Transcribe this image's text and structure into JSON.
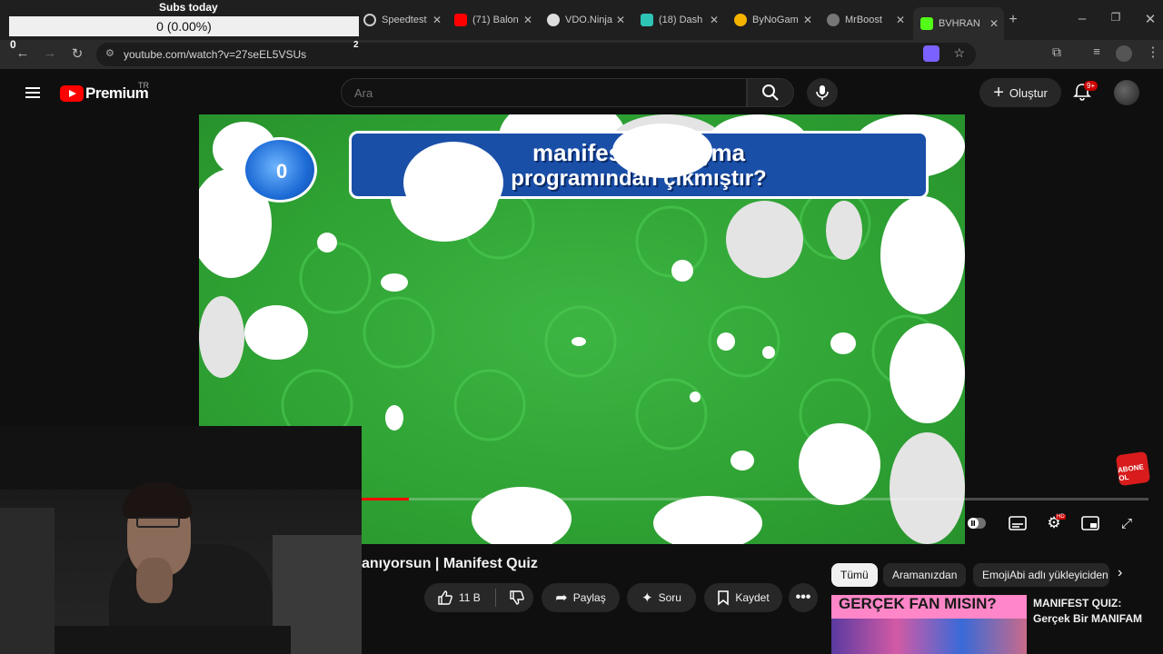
{
  "browser": {
    "tabs": [
      {
        "label": "Speedtest",
        "icon": "speedtest-icon",
        "color": "#1a1a1a"
      },
      {
        "label": "(71) Balon",
        "icon": "youtube-icon",
        "color": "#ff0000"
      },
      {
        "label": "VDO.Ninja",
        "icon": "vdo-icon",
        "color": "#dddddd"
      },
      {
        "label": "(18) Dash",
        "icon": "dashboard-icon",
        "color": "#2ec4b6"
      },
      {
        "label": "ByNoGam",
        "icon": "nogam-icon",
        "color": "#f5b400"
      },
      {
        "label": "MrBoost",
        "icon": "globe-icon",
        "color": "#777777"
      },
      {
        "label": "BVHRAN",
        "icon": "kick-icon",
        "color": "#53fc18"
      }
    ],
    "url": "youtube.com/watch?v=27seEL5VSUs"
  },
  "overlay": {
    "title": "Subs today",
    "value": "0 (0.00%)",
    "left_count": "0",
    "right_count": "2"
  },
  "youtube": {
    "logo_text": "Premium",
    "region": "TR",
    "search_placeholder": "Ara",
    "create_label": "Oluştur",
    "notification_badge": "9+"
  },
  "video": {
    "question_line1": "manifest gu... ışma",
    "question_line2": "programından çıkmıştır?",
    "timer_value": "0",
    "progress_fraction": 0.06,
    "subscribe_sticker": "ABONE OL",
    "title": "anıyorsun | Manifest Quiz",
    "likes": "11 B",
    "share_label": "Paylaş",
    "ask_label": "Soru",
    "save_label": "Kaydet"
  },
  "sidebar": {
    "chips": [
      "Tümü",
      "Aramanızdan",
      "EmojiAbi adlı yükleyiciden"
    ],
    "rec_thumb_text": "GERÇEK FAN MISIN?",
    "rec_title": "MANIFEST QUIZ: Gerçek Bir MANIFAM"
  }
}
